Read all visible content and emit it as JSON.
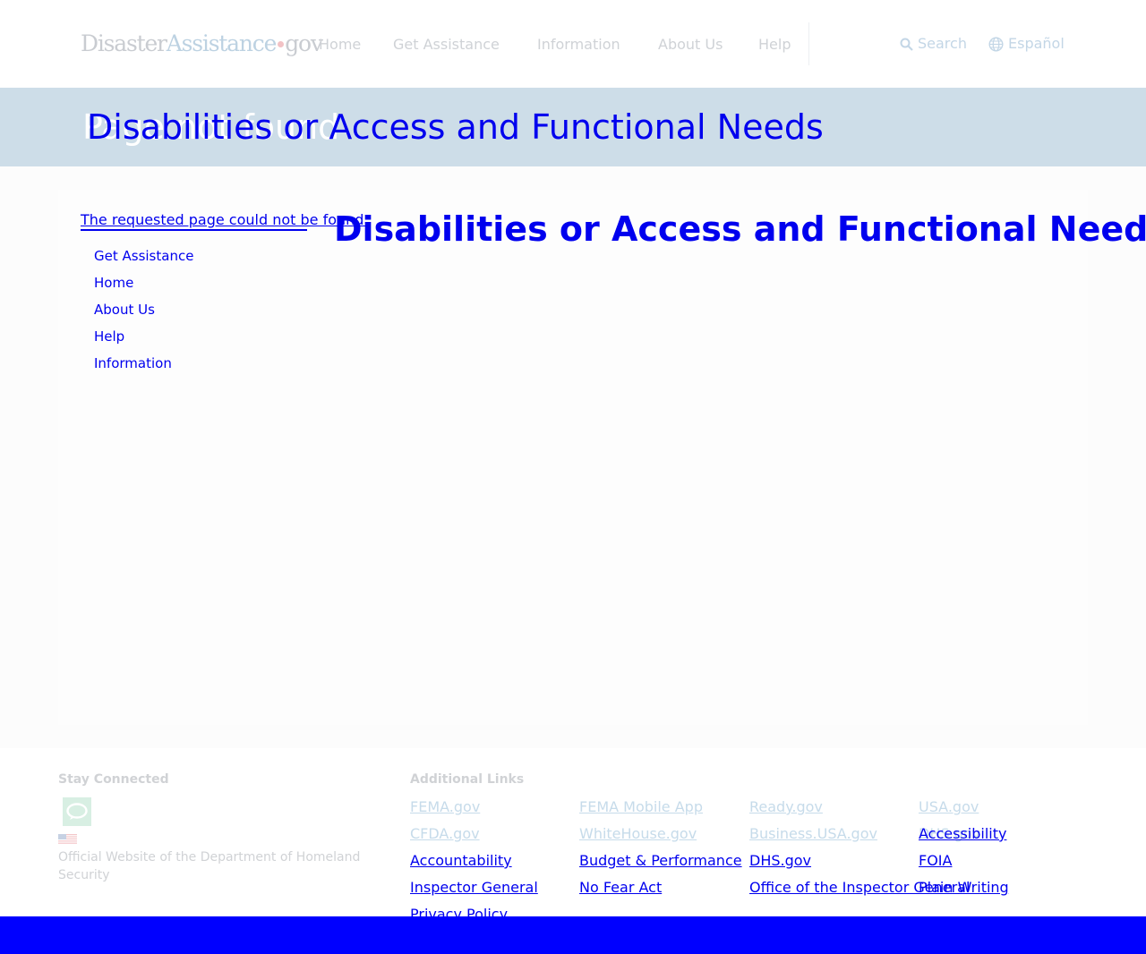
{
  "header": {
    "logo": {
      "part1": "Disaster",
      "part2": "Assistance",
      "part3": "gov"
    },
    "nav": [
      "Home",
      "Get Assistance",
      "Information",
      "About Us",
      "Help"
    ],
    "search_label": "Search",
    "language_label": "Español"
  },
  "banner": {
    "ghost_text": "Page not found",
    "title": "Disabilities or Access and Functional Needs"
  },
  "main": {
    "not_found_message": "The requested page could not be found.",
    "sidenav": [
      "Get Assistance",
      "Home",
      "About Us",
      "Help",
      "Information"
    ],
    "content_title": "Disabilities or Access and Functional Needs"
  },
  "footer": {
    "stay_connected": "Stay Connected",
    "official_text": "Official Website of the Department of Homeland Security",
    "additional_links_heading": "Additional Links",
    "links": {
      "fema": "FEMA.gov",
      "fema_app": "FEMA Mobile App",
      "ready": "Ready.gov",
      "usa": "USA.gov",
      "cfda": "CFDA.gov",
      "whitehouse": "WhiteHouse.gov",
      "business": "Business.USA.gov",
      "accessibility_ghost": "DHS.gov",
      "accessibility": "Accessibility",
      "accountability": "Accountability",
      "budget": "Budget & Performance",
      "dhs": "DHS.gov",
      "foia": "FOIA",
      "inspector": "Inspector General",
      "nofear": "No Fear Act",
      "oig": "Office of the Inspector General",
      "plain": "Plain Writing",
      "privacy": "Privacy Policy"
    }
  },
  "colors": {
    "banner_bg": "#cddde8",
    "link_blue": "#0000ee",
    "bottom_bar": "#0000ff"
  },
  "icons": [
    "search-icon",
    "globe-icon",
    "chat-icon",
    "us-flag-icon"
  ]
}
